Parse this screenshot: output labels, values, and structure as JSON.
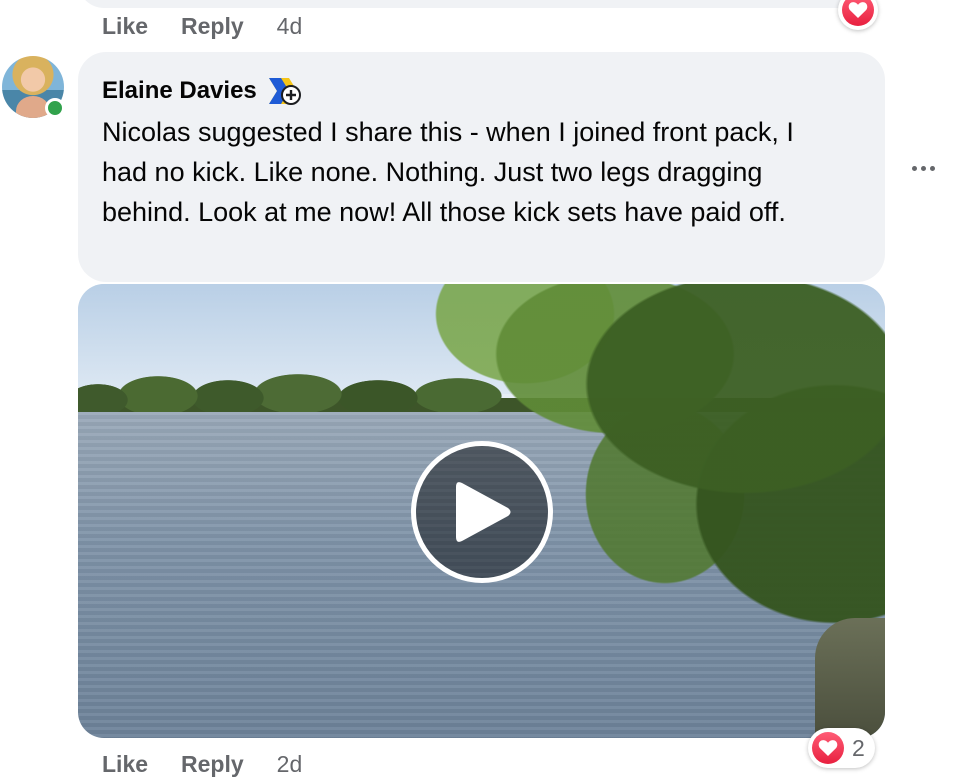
{
  "previous_comment": {
    "like_label": "Like",
    "reply_label": "Reply",
    "timestamp": "4d",
    "reaction_icon": "heart-icon"
  },
  "comment": {
    "author": "Elaine Davies",
    "author_badge_icon": "top-fan-badge-icon",
    "text": "Nicolas suggested I share this - when I joined front pack, I had no kick. Like none. Nothing. Just two legs dragging behind. Look at me now! All those kick sets have paid off.",
    "online": true,
    "video": {
      "play_icon": "play-icon"
    },
    "actions": {
      "like_label": "Like",
      "reply_label": "Reply",
      "timestamp": "2d"
    },
    "reactions": {
      "icon": "heart-icon",
      "count": "2"
    },
    "more_icon": "more-options-icon"
  },
  "colors": {
    "bubble_bg": "#f0f2f5",
    "secondary_text": "#65676b",
    "online_green": "#31a24c",
    "heart_red": "#f02849"
  }
}
